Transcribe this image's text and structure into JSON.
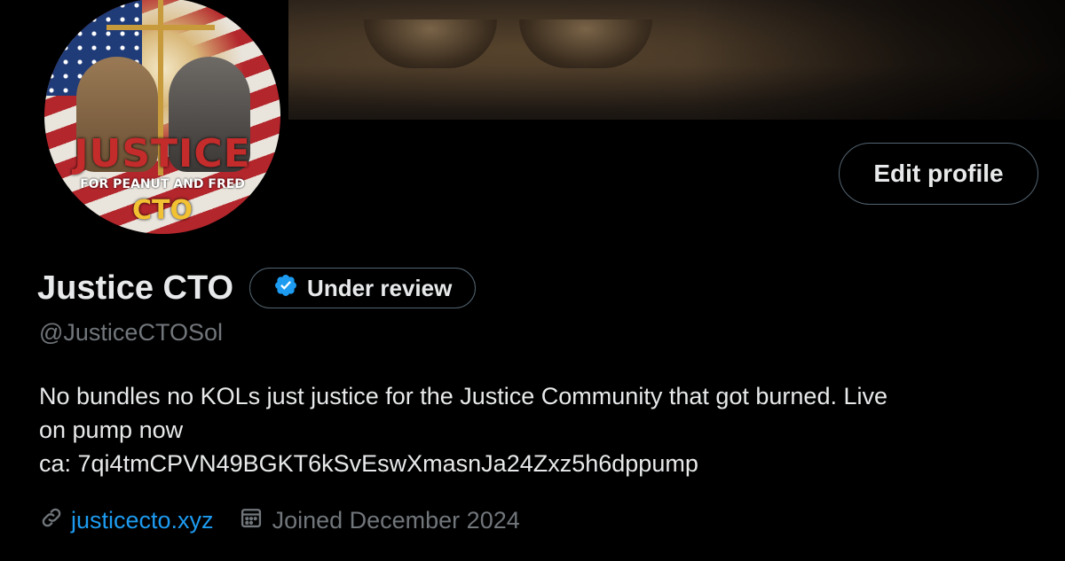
{
  "profile": {
    "display_name": "Justice CTO",
    "badge_label": "Under review",
    "handle": "@JusticeCTOSol",
    "bio_lines": [
      "No bundles no KOLs just justice for the Justice Community that got burned. Live",
      "on pump now",
      "ca: 7qi4tmCPVN49BGKT6kSvEswXmasnJa24Zxz5h6dppump"
    ],
    "website": "justicecto.xyz",
    "joined": "Joined December 2024",
    "edit_button": "Edit profile"
  },
  "avatar": {
    "line1": "JUSTICE",
    "line2": "FOR PEANUT AND FRED",
    "line3": "CTO"
  },
  "icons": {
    "verified": "verified-badge-icon",
    "link": "link-icon",
    "calendar": "calendar-icon"
  },
  "colors": {
    "background": "#000000",
    "text": "#e7e9ea",
    "muted": "#71767b",
    "link": "#1d9bf0",
    "border": "#536471"
  }
}
